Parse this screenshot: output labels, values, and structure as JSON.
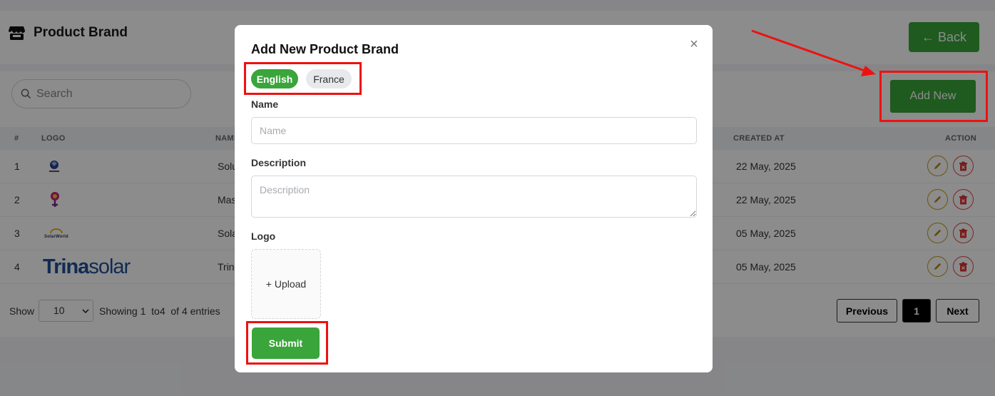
{
  "page": {
    "title": "Product Brand",
    "back_label": "← Back",
    "search_placeholder": "Search",
    "add_new_label": "Add New"
  },
  "table": {
    "headers": [
      "#",
      "LOGO",
      "NAME",
      "CREATED AT",
      "ACTION"
    ],
    "rows": [
      {
        "index": "1",
        "logo": "SolarEdge-logo",
        "name": "Solu",
        "created": "22 May, 2025"
      },
      {
        "index": "2",
        "logo": "Mascot-logo",
        "name": "Mas",
        "created": "22 May, 2025"
      },
      {
        "index": "3",
        "logo": "SolarWorld-logo",
        "logo_text": "SolarWorld",
        "name": "Sola",
        "created": "05 May, 2025"
      },
      {
        "index": "4",
        "logo": "Trinasolar-logo",
        "logo_text_a": "Trina",
        "logo_text_b": "solar",
        "name": "Trin",
        "created": "05 May, 2025"
      }
    ]
  },
  "footer": {
    "show_label": "Show",
    "page_size": "10",
    "entries_text": "Showing 1  to4  of 4 entries",
    "previous_label": "Previous",
    "current_page": "1",
    "next_label": "Next"
  },
  "modal": {
    "title": "Add New Product Brand",
    "close_icon": "×",
    "languages": [
      "English",
      "France"
    ],
    "name_label": "Name",
    "name_placeholder": "Name",
    "description_label": "Description",
    "description_placeholder": "Description",
    "logo_label": "Logo",
    "upload_label": "+ Upload",
    "submit_label": "Submit"
  },
  "colors": {
    "primary_green": "#3aa53a",
    "highlight_red": "#ee1111",
    "edit_gold": "#c69a16",
    "delete_red": "#e04545"
  }
}
